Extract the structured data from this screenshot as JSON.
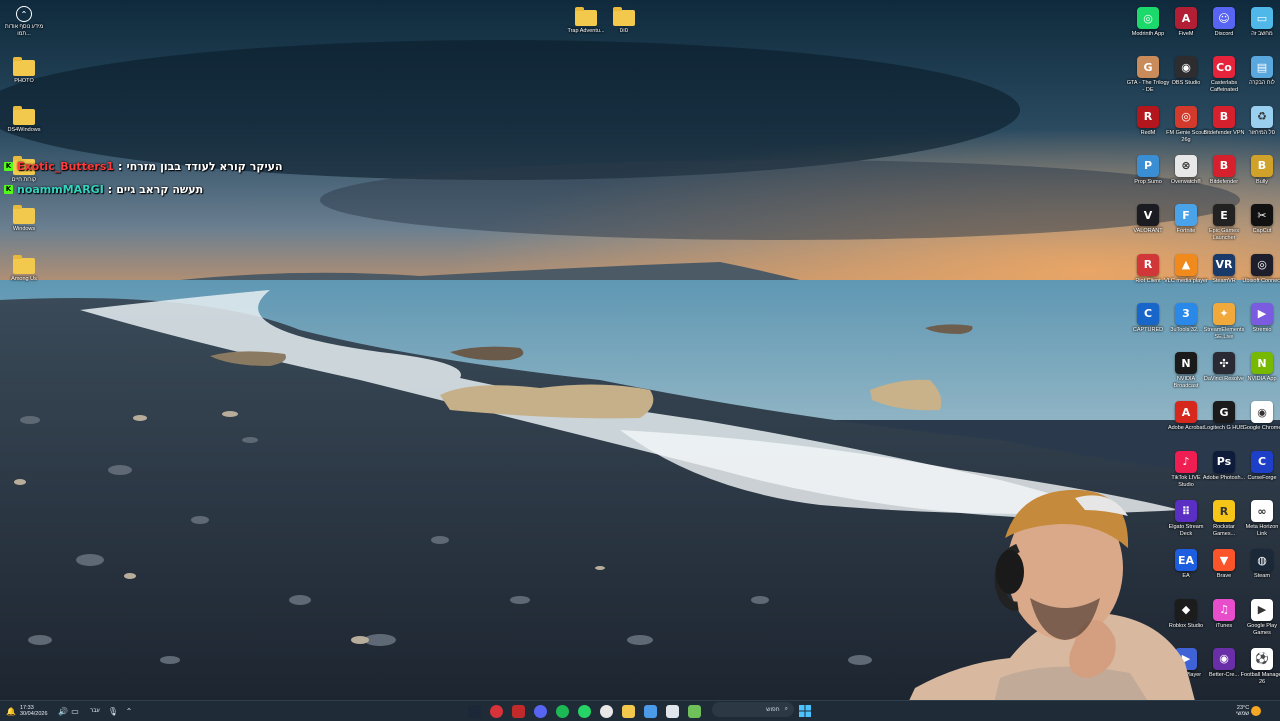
{
  "desktop": {
    "left_icons": [
      {
        "label": "מידע נוסף אודות תמו...",
        "icon": "info-circle-icon",
        "kind": "app"
      },
      {
        "label": "PHOTO",
        "icon": "folder-icon",
        "kind": "folder"
      },
      {
        "label": "DS4Windows",
        "icon": "folder-icon",
        "kind": "folder"
      },
      {
        "label": "קורות חיים",
        "icon": "folder-icon",
        "kind": "folder"
      },
      {
        "label": "Windows",
        "icon": "folder-icon",
        "kind": "folder"
      },
      {
        "label": "Among Us",
        "icon": "folder-icon",
        "kind": "folder"
      }
    ],
    "top_icons": [
      {
        "label": "Trap Adventu...",
        "icon": "folder-icon"
      },
      {
        "label": "סוס",
        "icon": "folder-icon"
      }
    ],
    "right_columns": [
      [
        {
          "label": "Modrinth App",
          "icon": "modrinth-icon",
          "color": "#1bd96a",
          "glyph": "◎"
        },
        {
          "label": "GTA - The Trilogy - DE",
          "icon": "gta-icon",
          "color": "#c98b5a",
          "glyph": "G"
        },
        {
          "label": "RedM",
          "icon": "redm-icon",
          "color": "#b3171d",
          "glyph": "R"
        },
        {
          "label": "Prop Sumo",
          "icon": "prop-sumo-icon",
          "color": "#3a8fd4",
          "glyph": "P"
        },
        {
          "label": "VALORANT",
          "icon": "valorant-icon",
          "color": "#1b1b22",
          "glyph": "V"
        },
        {
          "label": "Riot Client",
          "icon": "riot-client-icon",
          "color": "#d13639",
          "glyph": "R"
        },
        {
          "label": "CAPTURED",
          "icon": "captured-icon",
          "color": "#1866c9",
          "glyph": "C"
        }
      ],
      [
        {
          "label": "FiveM",
          "icon": "fivem-icon",
          "color": "#b21f34",
          "glyph": "A"
        },
        {
          "label": "OBS Studio",
          "icon": "obs-icon",
          "color": "#2d2d30",
          "glyph": "◉"
        },
        {
          "label": "FM Genie Scout 26g",
          "icon": "fm-genie-icon",
          "color": "#d33a2c",
          "glyph": "◎"
        },
        {
          "label": "Overwatch®",
          "icon": "overwatch-icon",
          "color": "#e8e8e8",
          "glyph": "⊗"
        },
        {
          "label": "Fortnite",
          "icon": "fortnite-icon",
          "color": "#4aa3e8",
          "glyph": "F"
        },
        {
          "label": "VLC media player",
          "icon": "vlc-icon",
          "color": "#f08a1c",
          "glyph": "▲"
        },
        {
          "label": "3uTools 32...",
          "icon": "3utools-icon",
          "color": "#2a88e8",
          "glyph": "3"
        },
        {
          "label": "NVIDIA Broadcast",
          "icon": "nvidia-broadcast-icon",
          "color": "#1a1a1a",
          "glyph": "N"
        },
        {
          "label": "Adobe Acrobat",
          "icon": "acrobat-icon",
          "color": "#d7281e",
          "glyph": "A"
        },
        {
          "label": "TikTok LIVE Studio",
          "icon": "tiktok-icon",
          "color": "#ee1d52",
          "glyph": "♪"
        },
        {
          "label": "Elgato Stream Deck",
          "icon": "stream-deck-icon",
          "color": "#5b2ec4",
          "glyph": "⠿"
        },
        {
          "label": "EA",
          "icon": "ea-icon",
          "color": "#1d5ee0",
          "glyph": "EA"
        },
        {
          "label": "Roblox Studio",
          "icon": "roblox-icon",
          "color": "#1c1c1c",
          "glyph": "◆"
        },
        {
          "label": "Lucid Player",
          "icon": "lucid-player-icon",
          "color": "#3f63d6",
          "glyph": "▶"
        }
      ],
      [
        {
          "label": "Discord",
          "icon": "discord-icon",
          "color": "#5865f2",
          "glyph": "☺"
        },
        {
          "label": "Casterlabs Caffeinated",
          "icon": "casterlabs-icon",
          "color": "#e5243b",
          "glyph": "Co"
        },
        {
          "label": "Bitdefender VPN",
          "icon": "bitdefender-vpn-icon",
          "color": "#d6202d",
          "glyph": "B"
        },
        {
          "label": "Bitdefender",
          "icon": "bitdefender-icon",
          "color": "#d6202d",
          "glyph": "B"
        },
        {
          "label": "Epic Games Launcher",
          "icon": "epic-games-icon",
          "color": "#222222",
          "glyph": "E"
        },
        {
          "label": "SteamVR",
          "icon": "steamvr-icon",
          "color": "#1a3a6a",
          "glyph": "VR"
        },
        {
          "label": "StreamElements SE.Live",
          "icon": "streamelements-icon",
          "color": "#f0a93a",
          "glyph": "✦"
        },
        {
          "label": "DaVinci Resolve",
          "icon": "davinci-icon",
          "color": "#2a2a34",
          "glyph": "✣"
        },
        {
          "label": "Logitech G HUB",
          "icon": "ghub-icon",
          "color": "#1b1b1b",
          "glyph": "G"
        },
        {
          "label": "Adobe Photosh...",
          "icon": "photoshop-icon",
          "color": "#0f1b3a",
          "glyph": "Ps"
        },
        {
          "label": "Rockstar Games...",
          "icon": "rockstar-icon",
          "color": "#f5c518",
          "glyph": "R"
        },
        {
          "label": "Brave",
          "icon": "brave-icon",
          "color": "#fb542b",
          "glyph": "▼"
        },
        {
          "label": "iTunes",
          "icon": "itunes-icon",
          "color": "#e84ecb",
          "glyph": "♫"
        },
        {
          "label": "Better-Cre...",
          "icon": "better-crewlink-icon",
          "color": "#6a2ea8",
          "glyph": "◉"
        }
      ],
      [
        {
          "label": "מחשב זה",
          "icon": "this-pc-icon",
          "color": "#4fb8e8",
          "glyph": "▭"
        },
        {
          "label": "לוח הבקרה",
          "icon": "control-panel-icon",
          "color": "#5aa7dd",
          "glyph": "▤"
        },
        {
          "label": "סל המיחזור",
          "icon": "recycle-bin-icon",
          "color": "#9ad0ef",
          "glyph": "♻"
        },
        {
          "label": "Bully",
          "icon": "bully-icon",
          "color": "#d1a22a",
          "glyph": "B"
        },
        {
          "label": "CapCut",
          "icon": "capcut-icon",
          "color": "#111111",
          "glyph": "✂"
        },
        {
          "label": "Ubisoft Connect",
          "icon": "ubisoft-icon",
          "color": "#1d1d2b",
          "glyph": "◎"
        },
        {
          "label": "Stremio",
          "icon": "stremio-icon",
          "color": "#7b5bdf",
          "glyph": "▶"
        },
        {
          "label": "NVIDIA App",
          "icon": "nvidia-app-icon",
          "color": "#76b900",
          "glyph": "N"
        },
        {
          "label": "Google Chrome",
          "icon": "chrome-icon",
          "color": "#ffffff",
          "glyph": "◉"
        },
        {
          "label": "CurseForge",
          "icon": "curseforge-icon",
          "color": "#1e40c9",
          "glyph": "C"
        },
        {
          "label": "Meta Horizon Link",
          "icon": "meta-icon",
          "color": "#ffffff",
          "glyph": "∞"
        },
        {
          "label": "Steam",
          "icon": "steam-icon",
          "color": "#1b2838",
          "glyph": "◍"
        },
        {
          "label": "Google Play Games",
          "icon": "google-play-games-icon",
          "color": "#ffffff",
          "glyph": "▶"
        },
        {
          "label": "Football Manager 26",
          "icon": "football-manager-icon",
          "color": "#ffffff",
          "glyph": "⚽"
        }
      ]
    ]
  },
  "chat": [
    {
      "user": "Exotic_Butters1",
      "separator": ":",
      "message": "העיקר קורא לעודד בבון מזרחי",
      "user_color": "#ff3b3b"
    },
    {
      "user": "noammMARGI",
      "separator": ":",
      "message": "תעשה קראב גיים",
      "user_color": "#32d4c0"
    }
  ],
  "taskbar": {
    "time": "17:33",
    "date": "30/04/2026",
    "language": "עבר",
    "search_placeholder": "חפוש",
    "weather_temp": "23°C",
    "weather_desc": "שמשי",
    "apps": [
      "steam-icon",
      "chrome-red-icon",
      "screen-recorder-icon",
      "discord-icon",
      "spotify-icon",
      "whatsapp-icon",
      "chrome-icon",
      "file-explorer-icon",
      "task-manager-icon",
      "notepad-icon",
      "gallery-icon"
    ]
  }
}
